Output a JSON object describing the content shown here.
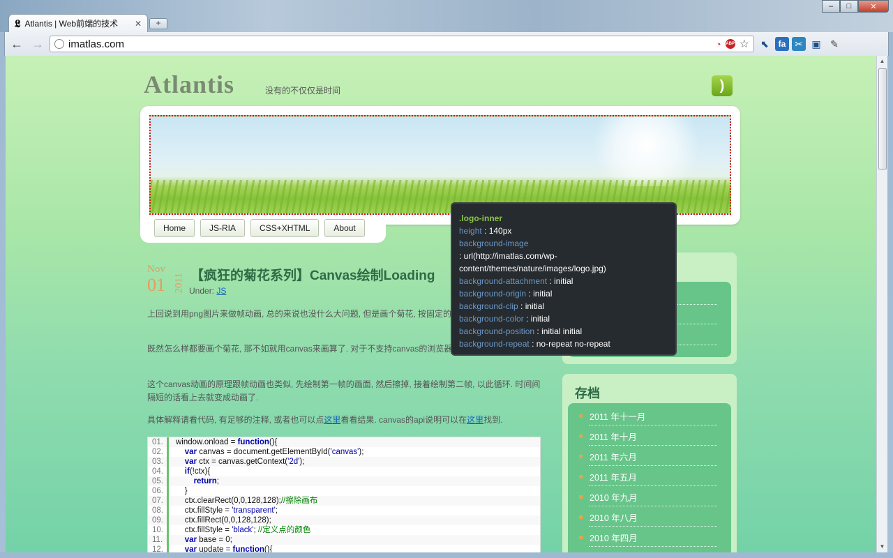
{
  "browser": {
    "tab_title": "Atlantis | Web前端的技术",
    "tab_favicon": "𝕷",
    "url": "imatlas.com",
    "win_minimize": "–",
    "win_maximize": "□",
    "win_close": "✕"
  },
  "site": {
    "title": "Atlantis",
    "tagline": "没有的不仅仅是时间"
  },
  "nav": [
    "Home",
    "JS-RIA",
    "CSS+XHTML",
    "About"
  ],
  "post": {
    "month": "Nov",
    "day": "01",
    "year": "2011",
    "title": "【疯狂的菊花系列】Canvas绘制Loading",
    "under_label": "Under:",
    "category": "JS",
    "p1": "上回说到用png图片来做帧动画, 总的来说也没什么大问题, 但是画个菊花, 按固定的……疼.",
    "p2": "既然怎么样都要画个菊花, 那不如就用canvas来画算了. 对于不支持canvas的浏览器……多.",
    "p3": "这个canvas动画的原理跟帧动画也类似, 先绘制第一帧的画面, 然后擦掉, 接着绘制第二帧, 以此循环. 时间间隔短的话看上去就变成动画了.",
    "p4_a": "具体解释请看代码, 有足够的注释, 或者也可以点",
    "p4_link1": "这里",
    "p4_b": "看看结果. canvas的api说明可以在",
    "p4_link2": "这里",
    "p4_c": "找到."
  },
  "code": [
    {
      "n": "01.",
      "html": "window.onload = <span class='k'>function</span>(){"
    },
    {
      "n": "02.",
      "html": "    <span class='k'>var</span> canvas = document.getElementById(<span class='s'>'canvas'</span>);"
    },
    {
      "n": "03.",
      "html": "    <span class='k'>var</span> ctx = canvas.getContext(<span class='s'>'2d'</span>);"
    },
    {
      "n": "04.",
      "html": "    <span class='k'>if</span>(!ctx){"
    },
    {
      "n": "05.",
      "html": "        <span class='k'>return</span>;"
    },
    {
      "n": "06.",
      "html": "    }"
    },
    {
      "n": "07.",
      "html": "    ctx.clearRect(0,0,128,128);<span class='c'>//擦除画布</span>"
    },
    {
      "n": "08.",
      "html": "    ctx.fillStyle = <span class='s'>'transparent'</span>;"
    },
    {
      "n": "09.",
      "html": "    ctx.fillRect(0,0,128,128);"
    },
    {
      "n": "10.",
      "html": "    ctx.fillStyle = <span class='s'>'black'</span>; <span class='c'>//定义点的颜色</span>"
    },
    {
      "n": "11.",
      "html": "    <span class='k'>var</span> base = 0;"
    },
    {
      "n": "12.",
      "html": "    <span class='k'>var</span> update = <span class='k'>function</span>(){"
    }
  ],
  "sidebar": {
    "archive_title": "存档",
    "archives": [
      "2011 年十一月",
      "2011 年十月",
      "2011 年六月",
      "2011 年五月",
      "2010 年九月",
      "2010 年八月",
      "2010 年四月"
    ]
  },
  "tooltip": {
    "selector": ".logo-inner",
    "props": [
      {
        "name": "height",
        "value": "140px"
      },
      {
        "name": "background-image",
        "value": ""
      },
      {
        "name": "",
        "value": "url(http://imatlas.com/wp-content/themes/nature/images/logo.jpg)"
      },
      {
        "name": "background-attachment",
        "value": "initial"
      },
      {
        "name": "background-origin",
        "value": "initial"
      },
      {
        "name": "background-clip",
        "value": "initial"
      },
      {
        "name": "background-color",
        "value": "initial"
      },
      {
        "name": "background-position",
        "value": "initial initial"
      },
      {
        "name": "background-repeat",
        "value": "no-repeat no-repeat"
      }
    ]
  },
  "icons": {
    "back": "←",
    "forward": "→",
    "rss": "◉",
    "wrench": "🔧",
    "star": "☆"
  }
}
